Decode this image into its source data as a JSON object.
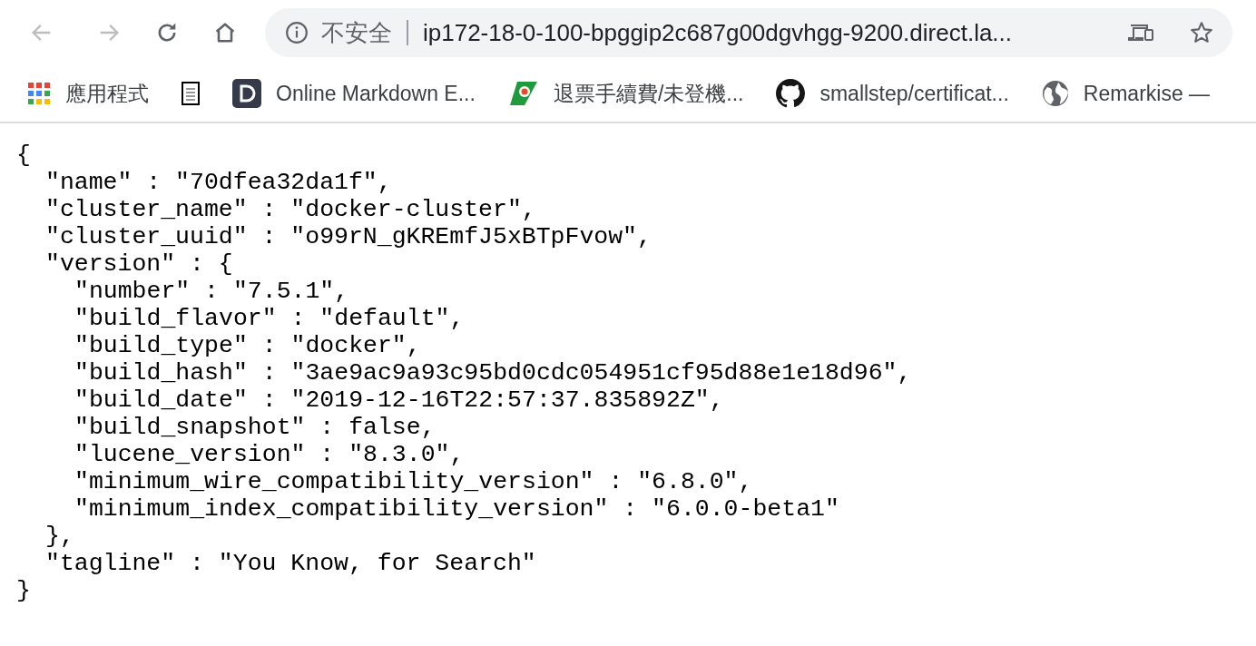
{
  "toolbar": {
    "back": {
      "disabled": true
    },
    "forward": {
      "disabled": true
    },
    "address_bar": {
      "security_label": "不安全",
      "url": "ip172-18-0-100-bpggip2c687g00dgvhgg-9200.direct.la..."
    }
  },
  "bookmarks": [
    {
      "kind": "labeled",
      "label": "應用程式"
    },
    {
      "kind": "icon"
    },
    {
      "kind": "labeled",
      "label": "Online Markdown E..."
    },
    {
      "kind": "labeled",
      "label": "退票手續費/未登機..."
    },
    {
      "kind": "labeled",
      "label": "smallstep/certificat..."
    },
    {
      "kind": "labeled",
      "label": "Remarkise —"
    }
  ],
  "page": {
    "lines": [
      {
        "text": "{",
        "children": [
          {
            "text": "\"name\" : \"70dfea32da1f\","
          },
          {
            "text": "\"cluster_name\" : \"docker-cluster\","
          },
          {
            "text": "\"cluster_uuid\" : \"o99rN_gKREmfJ5xBTpFvow\","
          },
          {
            "text": "\"version\" : {",
            "children": [
              {
                "text": "\"number\" : \"7.5.1\","
              },
              {
                "text": "\"build_flavor\" : \"default\","
              },
              {
                "text": "\"build_type\" : \"docker\","
              },
              {
                "text": "\"build_hash\" : \"3ae9ac9a93c95bd0cdc054951cf95d88e1e18d96\","
              },
              {
                "text": "\"build_date\" : \"2019-12-16T22:57:37.835892Z\","
              },
              {
                "text": "\"build_snapshot\" : false,"
              },
              {
                "text": "\"lucene_version\" : \"8.3.0\","
              },
              {
                "text": "\"minimum_wire_compatibility_version\" : \"6.8.0\","
              },
              {
                "text": "\"minimum_index_compatibility_version\" : \"6.0.0-beta1\""
              }
            ]
          },
          {
            "text": "},"
          },
          {
            "text": "\"tagline\" : \"You Know, for Search\""
          }
        ]
      },
      {
        "text": "}"
      }
    ]
  }
}
